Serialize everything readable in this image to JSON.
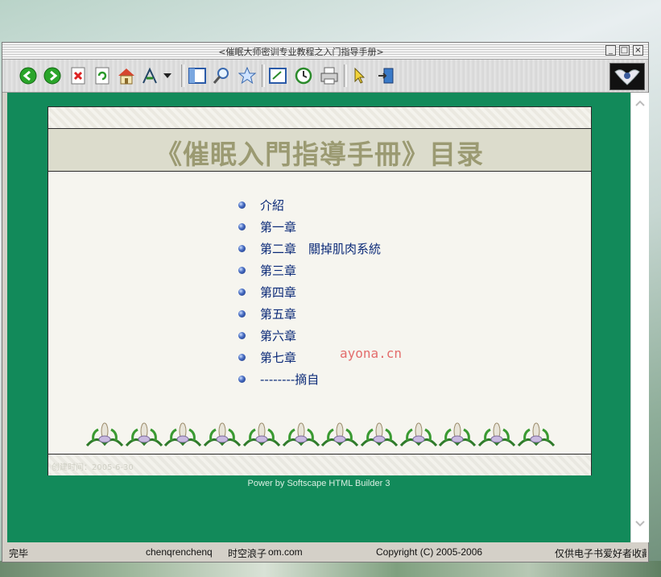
{
  "window": {
    "title": "<催眠大师密训专业教程之入门指导手册>",
    "minimize_glyph": "_",
    "maximize_glyph": "□",
    "close_glyph": "×"
  },
  "toolbar": {
    "icons": [
      "back-icon",
      "forward-icon",
      "stop-icon",
      "refresh-icon",
      "home-icon",
      "font-size-icon",
      "dropdown-arrow-icon",
      "contents-icon",
      "search-icon",
      "favorites-icon",
      "fullscreen-icon",
      "history-icon",
      "print-icon",
      "pointer-icon",
      "exit-icon"
    ]
  },
  "page": {
    "title": "《催眠入門指導手冊》目录",
    "toc": [
      "介紹",
      "第一章",
      "第二章　關掉肌肉系統",
      "第三章",
      "第四章",
      "第五章",
      "第六章",
      "第七章",
      "--------摘自"
    ],
    "watermark": "ayona.cn",
    "created": "创建时间：2005-6-30",
    "powered_by": "Power by Softscape HTML Builder 3"
  },
  "status": {
    "cell1": "完毕",
    "cell2": "chenqrenchenq",
    "cell3": "时空浪子",
    "cell4": "om.com",
    "cell5": "Copyright (C) 2005-2006",
    "cell6": "仅供电子书爱好者收藏"
  },
  "colors": {
    "viewport_bg": "#128a5a",
    "title_color": "#9b9a72",
    "link_color": "#0b2a78",
    "panel_bg": "#f6f5ef"
  }
}
